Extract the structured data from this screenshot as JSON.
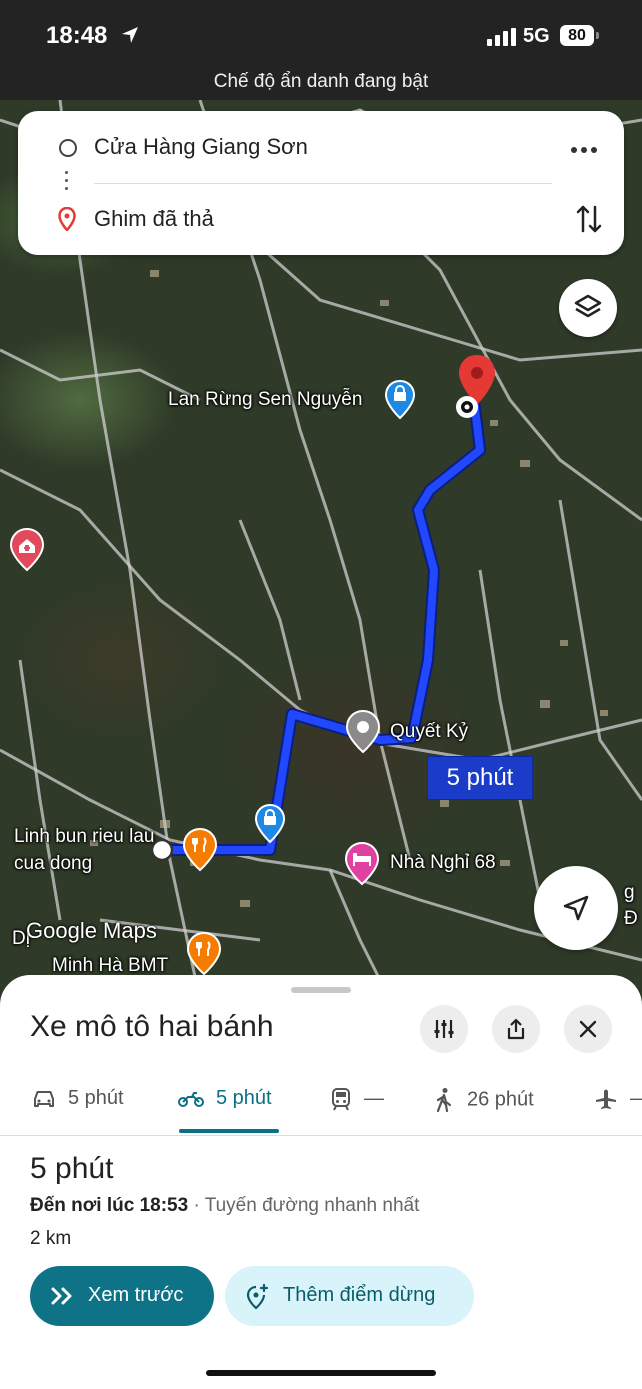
{
  "status_bar": {
    "time": "18:48",
    "network": "5G",
    "battery": "80"
  },
  "banner": {
    "incognito_text": "Chế độ ẩn danh đang bật"
  },
  "search_card": {
    "origin": "Cửa Hàng Giang Sơn",
    "destination": "Ghim đã thả"
  },
  "map": {
    "poi_labels": {
      "lan_rung": "Lan Rừng Sen Nguyễn",
      "quyet_ky": "Quyết Kỷ",
      "nha_nghi": "Nhà Nghỉ 68",
      "linh_bun_line1": "Linh bun rieu lau",
      "linh_bun_line2": "cua dong",
      "minh_ha": "Minh Hà BMT",
      "partial_left": "Dị",
      "partial_right_1": "g",
      "partial_right_2": "Đ"
    },
    "duration_chip": "5 phút",
    "logo": "Google Maps",
    "route_color": "#1a3cf0",
    "destination_pin_color": "#e53935"
  },
  "sheet": {
    "mode_title": "Xe mô tô hai bánh",
    "tabs": [
      {
        "icon": "car-icon",
        "label": "5 phút"
      },
      {
        "icon": "motorcycle-icon",
        "label": "5 phút"
      },
      {
        "icon": "transit-icon",
        "label": "—"
      },
      {
        "icon": "walk-icon",
        "label": "26 phút"
      },
      {
        "icon": "flight-icon",
        "label": "—"
      }
    ],
    "route_time": "5 phút",
    "arrive_label": "Đến nơi lúc 18:53",
    "arrive_sep": "·",
    "fastest": "Tuyến đường nhanh nhất",
    "distance": "2 km",
    "preview_button": "Xem trước",
    "add_stop_button": "Thêm điểm dừng",
    "accent_color": "#0e7386"
  }
}
